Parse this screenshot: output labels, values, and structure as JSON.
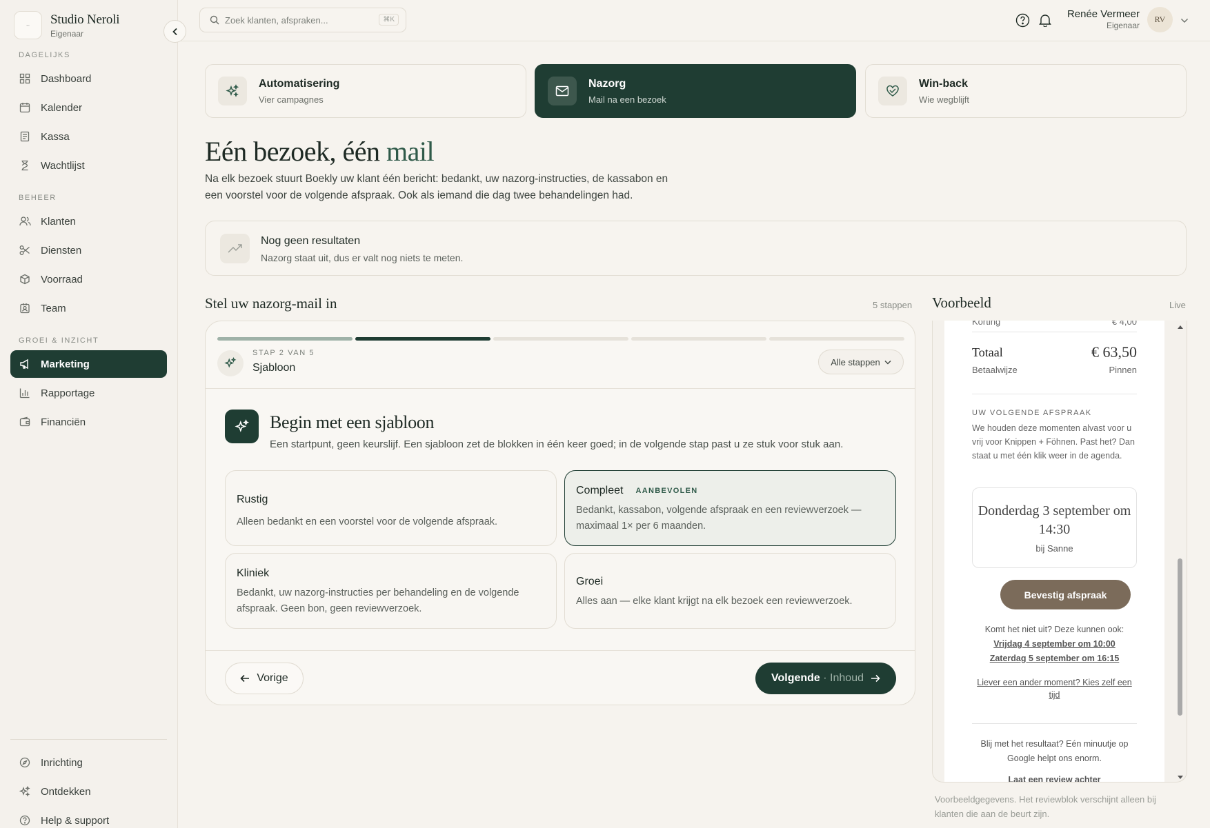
{
  "brand": {
    "name": "Studio Neroli",
    "role": "Eigenaar"
  },
  "search": {
    "placeholder": "Zoek klanten, afspraken...",
    "shortcut": "⌘K"
  },
  "user": {
    "name": "Renée Vermeer",
    "role": "Eigenaar",
    "initials": "RV"
  },
  "sidebar": {
    "sections": [
      {
        "label": "DAGELIJKS"
      },
      {
        "label": "BEHEER"
      },
      {
        "label": "GROEI & INZICHT"
      }
    ],
    "items": [
      {
        "label": "Dashboard",
        "icon": "grid-icon"
      },
      {
        "label": "Kalender",
        "icon": "calendar-icon"
      },
      {
        "label": "Kassa",
        "icon": "receipt-icon"
      },
      {
        "label": "Wachtlijst",
        "icon": "hourglass-icon"
      },
      {
        "label": "Klanten",
        "icon": "users-icon"
      },
      {
        "label": "Diensten",
        "icon": "scissors-icon"
      },
      {
        "label": "Voorraad",
        "icon": "box-icon"
      },
      {
        "label": "Team",
        "icon": "badge-icon"
      },
      {
        "label": "Marketing",
        "icon": "megaphone-icon",
        "active": true
      },
      {
        "label": "Rapportage",
        "icon": "bar-chart-icon"
      },
      {
        "label": "Financiën",
        "icon": "wallet-icon"
      }
    ],
    "bottom": [
      {
        "label": "Inrichting",
        "icon": "compass-icon"
      },
      {
        "label": "Ontdekken",
        "icon": "sparkles-icon"
      },
      {
        "label": "Help & support",
        "icon": "help-icon"
      }
    ]
  },
  "tabs": [
    {
      "title": "Automatisering",
      "subtitle": "Vier campagnes",
      "icon": "sparkles-icon"
    },
    {
      "title": "Nazorg",
      "subtitle": "Mail na een bezoek",
      "icon": "mail-icon",
      "active": true
    },
    {
      "title": "Win-back",
      "subtitle": "Wie wegblijft",
      "icon": "heart-handshake-icon"
    }
  ],
  "hero": {
    "title_main": "Eén bezoek, één",
    "title_accent": "mail",
    "description": "Na elk bezoek stuurt Boekly uw klant één bericht: bedankt, uw nazorg-instructies, de kassabon en een voorstel voor de volgende afspraak. Ook als iemand die dag twee behandelingen had."
  },
  "results": {
    "title": "Nog geen resultaten",
    "subtitle": "Nazorg staat uit, dus er valt nog niets te meten."
  },
  "wizard": {
    "title": "Stel uw nazorg-mail in",
    "steps_count": "5 stappen",
    "progress": {
      "current": 2,
      "total": 5
    },
    "step_label": "STAP 2 VAN 5",
    "step_name": "Sjabloon",
    "all_steps_label": "Alle stappen",
    "template_title": "Begin met een sjabloon",
    "template_desc": "Een startpunt, geen keurslijf. Een sjabloon zet de blokken in één keer goed; in de volgende stap past u ze stuk voor stuk aan.",
    "options": [
      {
        "title": "Rustig",
        "desc": "Alleen bedankt en een voorstel voor de volgende afspraak."
      },
      {
        "title": "Compleet",
        "badge": "AANBEVOLEN",
        "desc": "Bedankt, kassabon, volgende afspraak en een reviewverzoek — maximaal 1× per 6 maanden.",
        "selected": true
      },
      {
        "title": "Kliniek",
        "desc": "Bedankt, uw nazorg-instructies per behandeling en de volgende afspraak. Geen bon, geen reviewverzoek."
      },
      {
        "title": "Groei",
        "desc": "Alles aan — elke klant krijgt na elk bezoek een reviewverzoek."
      }
    ],
    "prev_label": "Vorige",
    "next_label": "Volgende",
    "next_sub": "· Inhoud"
  },
  "preview": {
    "title": "Voorbeeld",
    "live": "Live",
    "cut_label": "Korting",
    "cut_value": "€ 4,00",
    "total_label": "Totaal",
    "total_value": "€ 63,50",
    "payment_label": "Betaalwijze",
    "payment_value": "Pinnen",
    "next_label": "UW VOLGENDE AFSPRAAK",
    "next_text": "We houden deze momenten alvast voor u vrij voor Knippen + Föhnen. Past het? Dan staat u met één klik weer in de agenda.",
    "appt_date": "Donderdag 3 september om 14:30",
    "appt_with": "bij Sanne",
    "confirm_label": "Bevestig afspraak",
    "alt_intro": "Komt het niet uit? Deze kunnen ook:",
    "alt_1": "Vrijdag 4 september om 10:00",
    "alt_2": "Zaterdag 5 september om 16:15",
    "own_time": "Liever een ander moment? Kies zelf een tijd",
    "review_text": "Blij met het resultaat? Eén minuutje op Google helpt ons enorm.",
    "review_link": "Laat een review achter",
    "footnote": "Voorbeeldgegevens. Het reviewblok verschijnt alleen bij klanten die aan de beurt zijn."
  },
  "colors": {
    "accent": "#1f3d33",
    "background": "#f6f3ee",
    "button_brown": "#7b6b5a"
  }
}
